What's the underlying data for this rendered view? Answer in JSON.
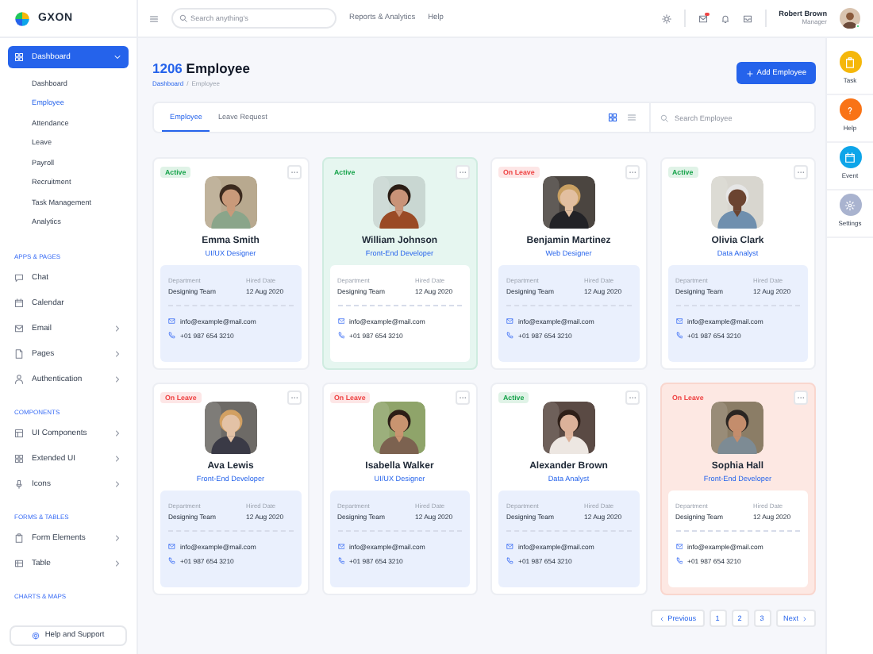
{
  "brand": {
    "name": "GXON"
  },
  "sidebar": {
    "groups": [
      {
        "items": [
          {
            "label": "Dashboard",
            "selected": true,
            "expanded": true,
            "has_submenu": true,
            "children": [
              {
                "label": "Dashboard",
                "selected": false
              },
              {
                "label": "Employee",
                "selected": true
              },
              {
                "label": "Attendance",
                "selected": false
              },
              {
                "label": "Leave",
                "selected": false
              },
              {
                "label": "Payroll",
                "selected": false
              },
              {
                "label": "Recruitment",
                "selected": false
              },
              {
                "label": "Task Management",
                "selected": false
              },
              {
                "label": "Analytics",
                "selected": false
              }
            ]
          }
        ]
      },
      {
        "title": "APPS & PAGES",
        "items": [
          {
            "label": "Chat",
            "selected": false,
            "has_submenu": false
          },
          {
            "label": "Calendar",
            "selected": false,
            "has_submenu": false
          },
          {
            "label": "Email",
            "selected": false,
            "has_submenu": true
          },
          {
            "label": "Pages",
            "selected": false,
            "has_submenu": true
          },
          {
            "label": "Authentication",
            "selected": false,
            "has_submenu": true
          }
        ]
      },
      {
        "title": "COMPONENTS",
        "items": [
          {
            "label": "UI Components",
            "selected": false,
            "has_submenu": true
          },
          {
            "label": "Extended UI",
            "selected": false,
            "has_submenu": true
          },
          {
            "label": "Icons",
            "selected": false,
            "has_submenu": true
          }
        ]
      },
      {
        "title": "FORMS & TABLES",
        "items": [
          {
            "label": "Form Elements",
            "selected": false,
            "has_submenu": true
          },
          {
            "label": "Table",
            "selected": false,
            "has_submenu": true
          }
        ]
      },
      {
        "title": "CHARTS & MAPS"
      }
    ],
    "help_button": "Help and Support"
  },
  "header": {
    "search": {
      "placeholder": "Search anything's"
    },
    "links": [
      "Reports & Analytics",
      "Help"
    ],
    "mail_unread": true,
    "user": {
      "name": "Robert Brown",
      "role": "Manager",
      "online": true
    }
  },
  "page": {
    "count": "1206",
    "title": "Employee",
    "breadcrumb": [
      "Dashboard",
      "Employee"
    ],
    "breadcrumb_separator": "/",
    "add_button": "Add Employee"
  },
  "toolbar": {
    "tabs": [
      {
        "label": "Employee",
        "selected": true
      },
      {
        "label": "Leave Request",
        "selected": false
      }
    ],
    "views": [
      {
        "selected": true
      },
      {
        "selected": false
      }
    ],
    "search": {
      "placeholder": "Search Employee"
    }
  },
  "employees": [
    {
      "name": "Emma Smith",
      "role": "UI/UX Designer",
      "status": {
        "label": "Active",
        "color": "#16a34a"
      },
      "kind": "plain",
      "department_label": "Department",
      "department": "Designing Team",
      "hired_label": "Hired Date",
      "hired": "12 Aug 2020",
      "email": "info@example@mail.com",
      "phone": "+01 987 654 3210"
    },
    {
      "name": "William Johnson",
      "role": "Front-End Developer",
      "status": {
        "label": "Active",
        "color": "#16a34a"
      },
      "kind": "mint",
      "department_label": "Department",
      "department": "Designing Team",
      "hired_label": "Hired Date",
      "hired": "12 Aug 2020",
      "email": "info@example@mail.com",
      "phone": "+01 987 654 3210"
    },
    {
      "name": "Benjamin Martinez",
      "role": "Web Designer",
      "status": {
        "label": "On Leave",
        "color": "#ef4444"
      },
      "kind": "plain",
      "department_label": "Department",
      "department": "Designing Team",
      "hired_label": "Hired Date",
      "hired": "12 Aug 2020",
      "email": "info@example@mail.com",
      "phone": "+01 987 654 3210"
    },
    {
      "name": "Olivia Clark",
      "role": "Data Analyst",
      "status": {
        "label": "Active",
        "color": "#16a34a"
      },
      "kind": "plain",
      "department_label": "Department",
      "department": "Designing Team",
      "hired_label": "Hired Date",
      "hired": "12 Aug 2020",
      "email": "info@example@mail.com",
      "phone": "+01 987 654 3210"
    },
    {
      "name": "Ava Lewis",
      "role": "Front-End Developer",
      "status": {
        "label": "On Leave",
        "color": "#ef4444"
      },
      "kind": "plain",
      "department_label": "Department",
      "department": "Designing Team",
      "hired_label": "Hired Date",
      "hired": "12 Aug 2020",
      "email": "info@example@mail.com",
      "phone": "+01 987 654 3210"
    },
    {
      "name": "Isabella Walker",
      "role": "UI/UX Designer",
      "status": {
        "label": "On Leave",
        "color": "#ef4444"
      },
      "kind": "plain",
      "department_label": "Department",
      "department": "Designing Team",
      "hired_label": "Hired Date",
      "hired": "12 Aug 2020",
      "email": "info@example@mail.com",
      "phone": "+01 987 654 3210"
    },
    {
      "name": "Alexander Brown",
      "role": "Data Analyst",
      "status": {
        "label": "Active",
        "color": "#16a34a"
      },
      "kind": "plain",
      "department_label": "Department",
      "department": "Designing Team",
      "hired_label": "Hired Date",
      "hired": "12 Aug 2020",
      "email": "info@example@mail.com",
      "phone": "+01 987 654 3210"
    },
    {
      "name": "Sophia Hall",
      "role": "Front-End Developer",
      "status": {
        "label": "On Leave",
        "color": "#ef4444"
      },
      "kind": "rose",
      "department_label": "Department",
      "department": "Designing Team",
      "hired_label": "Hired Date",
      "hired": "12 Aug 2020",
      "email": "info@example@mail.com",
      "phone": "+01 987 654 3210"
    }
  ],
  "pagination": {
    "previous": "Previous",
    "pages": [
      "1",
      "2",
      "3"
    ],
    "next": "Next"
  },
  "rail": [
    {
      "label": "Task",
      "color": "#f5b70a"
    },
    {
      "label": "Help",
      "color": "#f97316"
    },
    {
      "label": "Event",
      "color": "#0ea5e9"
    },
    {
      "label": "Settings",
      "color": "#a9b3cf"
    }
  ]
}
